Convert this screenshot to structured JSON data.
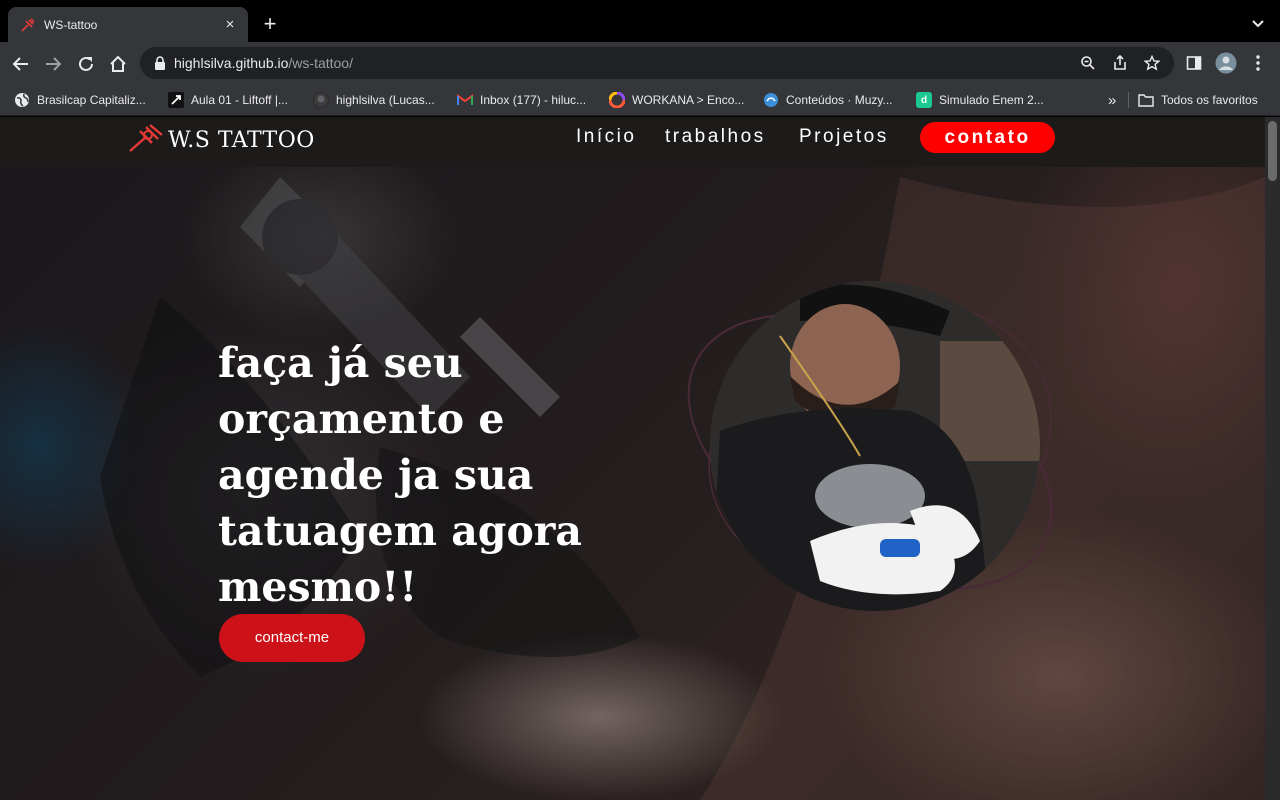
{
  "browser": {
    "tab": {
      "title": "WS-tattoo",
      "close": "×"
    },
    "new_tab": "+",
    "url_host": "highlsilva.github.io",
    "url_path": "/ws-tattoo/",
    "bookmarks": [
      {
        "label": "Brasilcap Capitaliz...",
        "icon": "globe-icon",
        "color": "#ffffff"
      },
      {
        "label": "Aula 01 - Liftoff |...",
        "icon": "liftoff-icon",
        "color": "#ffffff"
      },
      {
        "label": "highlsilva (Lucas...",
        "icon": "github-icon",
        "color": "#5f6368"
      },
      {
        "label": "Inbox (177) - hiluc...",
        "icon": "gmail-icon",
        "color": "#ea4335"
      },
      {
        "label": "WORKANA > Enco...",
        "icon": "workana-icon",
        "color": "#8a4cf5"
      },
      {
        "label": "Conteúdos · Muzy...",
        "icon": "muzy-icon",
        "color": "#3b8fd9"
      },
      {
        "label": "Simulado Enem 2...",
        "icon": "enem-icon",
        "color": "#1bc98e"
      }
    ],
    "more_bookmarks": "»",
    "all_favorites": "Todos os favoritos"
  },
  "site": {
    "logo_text": "W.S TATTOO",
    "nav": {
      "inicio": "Início",
      "trabalhos": "trabalhos",
      "projetos": "Projetos",
      "contato": "contato"
    },
    "headline": "faça já seu orçamento e agende ja sua tatuagem agora mesmo!!",
    "cta": "contact-me"
  },
  "colors": {
    "accent": "#ff0000",
    "cta": "#cc1118",
    "chrome_bg": "#35363a",
    "omnibox_bg": "#202124"
  }
}
